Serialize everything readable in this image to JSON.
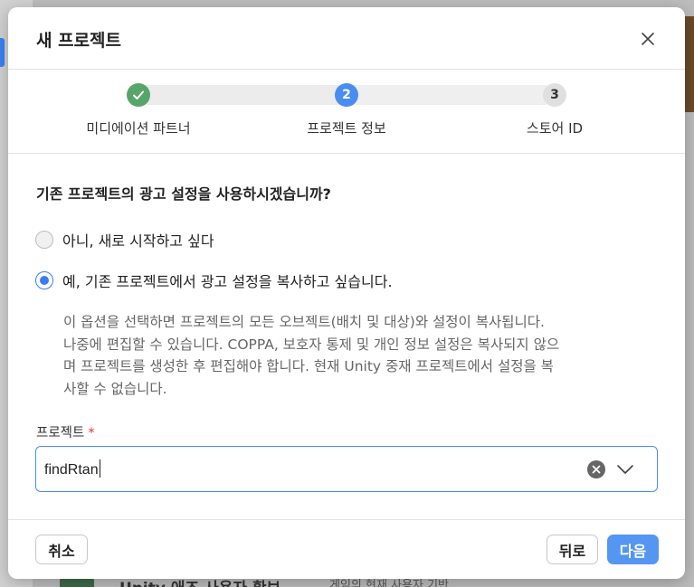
{
  "background": {
    "bottom_title": "Unity 애즈 사용자 확보",
    "bottom_sub": "게임의 현재 사용자 기반"
  },
  "modal": {
    "title": "새 프로젝트",
    "close_icon": "close-icon"
  },
  "stepper": {
    "steps": [
      {
        "number": "1",
        "label": "미디에이션 파트너",
        "state": "done",
        "icon": "check-icon"
      },
      {
        "number": "2",
        "label": "프로젝트 정보",
        "state": "active"
      },
      {
        "number": "3",
        "label": "스토어 ID",
        "state": "pending"
      }
    ]
  },
  "form": {
    "question": "기존 프로젝트의 광고 설정을 사용하시겠습니까?",
    "options": [
      {
        "label": "아니, 새로 시작하고 싶다",
        "checked": false
      },
      {
        "label": "예, 기존 프로젝트에서 광고 설정을 복사하고 싶습니다.",
        "checked": true
      }
    ],
    "description_lines": [
      "이 옵션을 선택하면 프로젝트의 모든 오브젝트(배치 및 대상)와 설정이 복사됩니다.",
      "나중에 편집할 수 있습니다. COPPA, 보호자 통제 및 개인 정보 설정은 복사되지 않으",
      "며 프로젝트를 생성한 후 편집해야 합니다. 현재 Unity 중재 프로젝트에서 설정을 복",
      "사할 수 없습니다."
    ],
    "project_field": {
      "label": "프로젝트",
      "required_mark": "*",
      "value": "findRtan"
    }
  },
  "footer": {
    "cancel_label": "취소",
    "back_label": "뒤로",
    "next_label": "다음"
  },
  "colors": {
    "accent": "#4a8df0",
    "done": "#58a569",
    "required": "#d9363e"
  }
}
